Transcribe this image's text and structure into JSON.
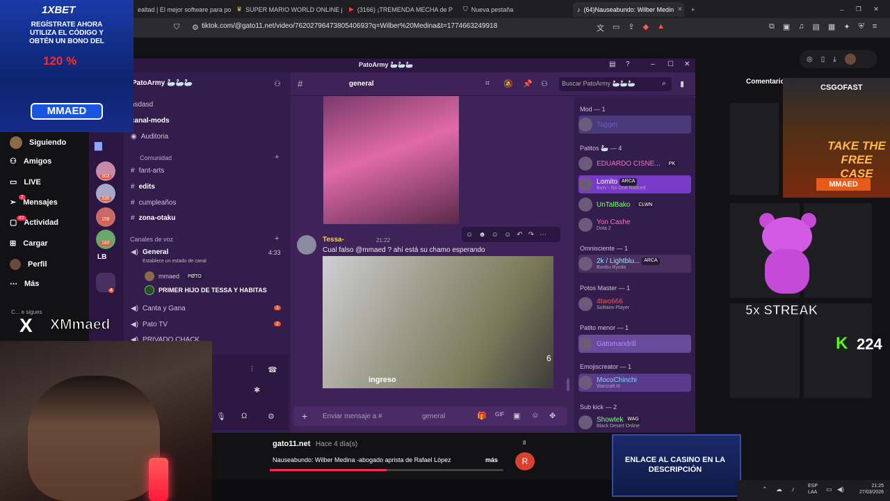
{
  "browser": {
    "tabs": [
      {
        "label": "ealtad | El mejor software para poté"
      },
      {
        "label": "SUPER MARIO WORLD ONLINE jueg"
      },
      {
        "label": "(3166) ¡TREMENDA MECHA de P"
      },
      {
        "label": "Nueva pestaña"
      },
      {
        "label": "(64)Nauseabundo: Wilber Medin"
      }
    ],
    "url": "tiktok.com/@gato11.net/video/7620279647380540693?q=Wilber%20Medina&t=1774663249918"
  },
  "tiktok": {
    "nav": [
      "Siguiendo",
      "Amigos",
      "LIVE",
      "Mensajes",
      "Actividad",
      "Cargar",
      "Perfil",
      "Más"
    ],
    "messages_count": "2",
    "activity_count": "42",
    "following_hint": "C... e sigues",
    "comments_label": "Comentario",
    "author": "gato11.net",
    "age": "Hace 4 día(s)",
    "caption": "Nauseabundo: Wilber Medina -abogado aprista de Rafael López",
    "more": "más",
    "avatar_letter": "R",
    "side_count": "8"
  },
  "discord": {
    "window_title": "PatoArmy 🦢🦢🦢",
    "server_name": "PatoArmy 🦢🦢🦢",
    "channel_name": "general",
    "search_placeholder": "Buscar PatoArmy 🦢🦢🦢",
    "guild_badges": [
      "303",
      "336",
      "158",
      "183",
      "4"
    ],
    "guild_lb": "LB",
    "channels": [
      {
        "name": "asdasd"
      },
      {
        "name": "canal-mods"
      },
      {
        "name": "Auditoria"
      }
    ],
    "category_comunidad": "Comunidad",
    "comunidad_channels": [
      {
        "name": "fant-arts"
      },
      {
        "name": "edits"
      },
      {
        "name": "cumpleaños"
      },
      {
        "name": "zona-otaku"
      }
    ],
    "category_voice": "Canales de voz",
    "voice_general": {
      "name": "General",
      "count": "4:33",
      "status": "Establece un estado de canal"
    },
    "voice_users": [
      {
        "name": "mmaed",
        "tag": "PØTO"
      },
      {
        "name": "PRIMER HIJO DE TESSA Y HABITAS"
      }
    ],
    "voice_channels": [
      {
        "name": "Canta y Gana",
        "badge": "1"
      },
      {
        "name": "Pato TV",
        "badge": "2"
      },
      {
        "name": "PRIVADO CHACK"
      }
    ],
    "message": {
      "author": "Tessa-",
      "time": "21:22",
      "text": "Cual falso @mmaed ? ahí está su chamo esperando",
      "video_label": "ingreso",
      "video_number": "6"
    },
    "input_placeholder": "Enviar mensaje a #",
    "input_channel": "general",
    "member_groups": [
      {
        "title": "Mod — 1",
        "members": [
          {
            "name": "Tagger",
            "status": "",
            "color": "#6a5acd"
          }
        ]
      },
      {
        "title": "Patitos 🦢 — 4",
        "members": [
          {
            "name": "EDUARDO CISNE...",
            "status": "",
            "color": "#ff6fb5",
            "badge": "PK"
          },
          {
            "name": "Lomito",
            "status": "Burv - No One Noticed",
            "color": "#ffffff",
            "badge": "ARCA"
          },
          {
            "name": "UnTalBako",
            "status": "",
            "color": "#7fff7f",
            "badge": "CLWN"
          },
          {
            "name": "Yon Cashe",
            "status": "Dota 2",
            "color": "#ff6fb5"
          }
        ]
      },
      {
        "title": "Omnisciente — 1",
        "members": [
          {
            "name": "2k / Lightblu...",
            "status": "Bunbu Ryodo",
            "color": "#7ff0ff",
            "badge": "ARCA"
          }
        ]
      },
      {
        "title": "Potos Master — 1",
        "members": [
          {
            "name": "4two666",
            "status": "Solitaire Player",
            "color": "#ff4f4f"
          }
        ]
      },
      {
        "title": "Patito menor — 1",
        "members": [
          {
            "name": "Gatomandrill",
            "status": "",
            "color": "#b48cff"
          }
        ]
      },
      {
        "title": "Emojiscreator — 1",
        "members": [
          {
            "name": "MocoChinchi",
            "status": "Warcraft III",
            "color": "#7fd7ff"
          }
        ]
      },
      {
        "title": "Sub kick — 2",
        "members": [
          {
            "name": "Showtek",
            "status": "Black Desert Online",
            "color": "#7fff7f",
            "badge": "WAG"
          }
        ]
      }
    ]
  },
  "overlays": {
    "ad1_brand": "1XBET",
    "ad1_text": "REGÍSTRATE AHORA UTILIZA EL CÓDIGO Y OBTÉN UN BONO DEL",
    "ad1_percent": "120 %",
    "ad1_code": "MMAED",
    "x_handle": "XMmaed",
    "ad2_brand": "CSGOFAST",
    "ad2_text": "TAKE THE FREE CASE",
    "ad2_code": "MMAED",
    "streak": "5x STREAK",
    "kick_count": "224",
    "ad3_text": "ENLACE AL CASINO EN LA DESCRIPCIÓN"
  },
  "taskbar": {
    "lang": "ESP",
    "lang2": "LAA",
    "time": "21:25",
    "date": "27/03/2026"
  }
}
